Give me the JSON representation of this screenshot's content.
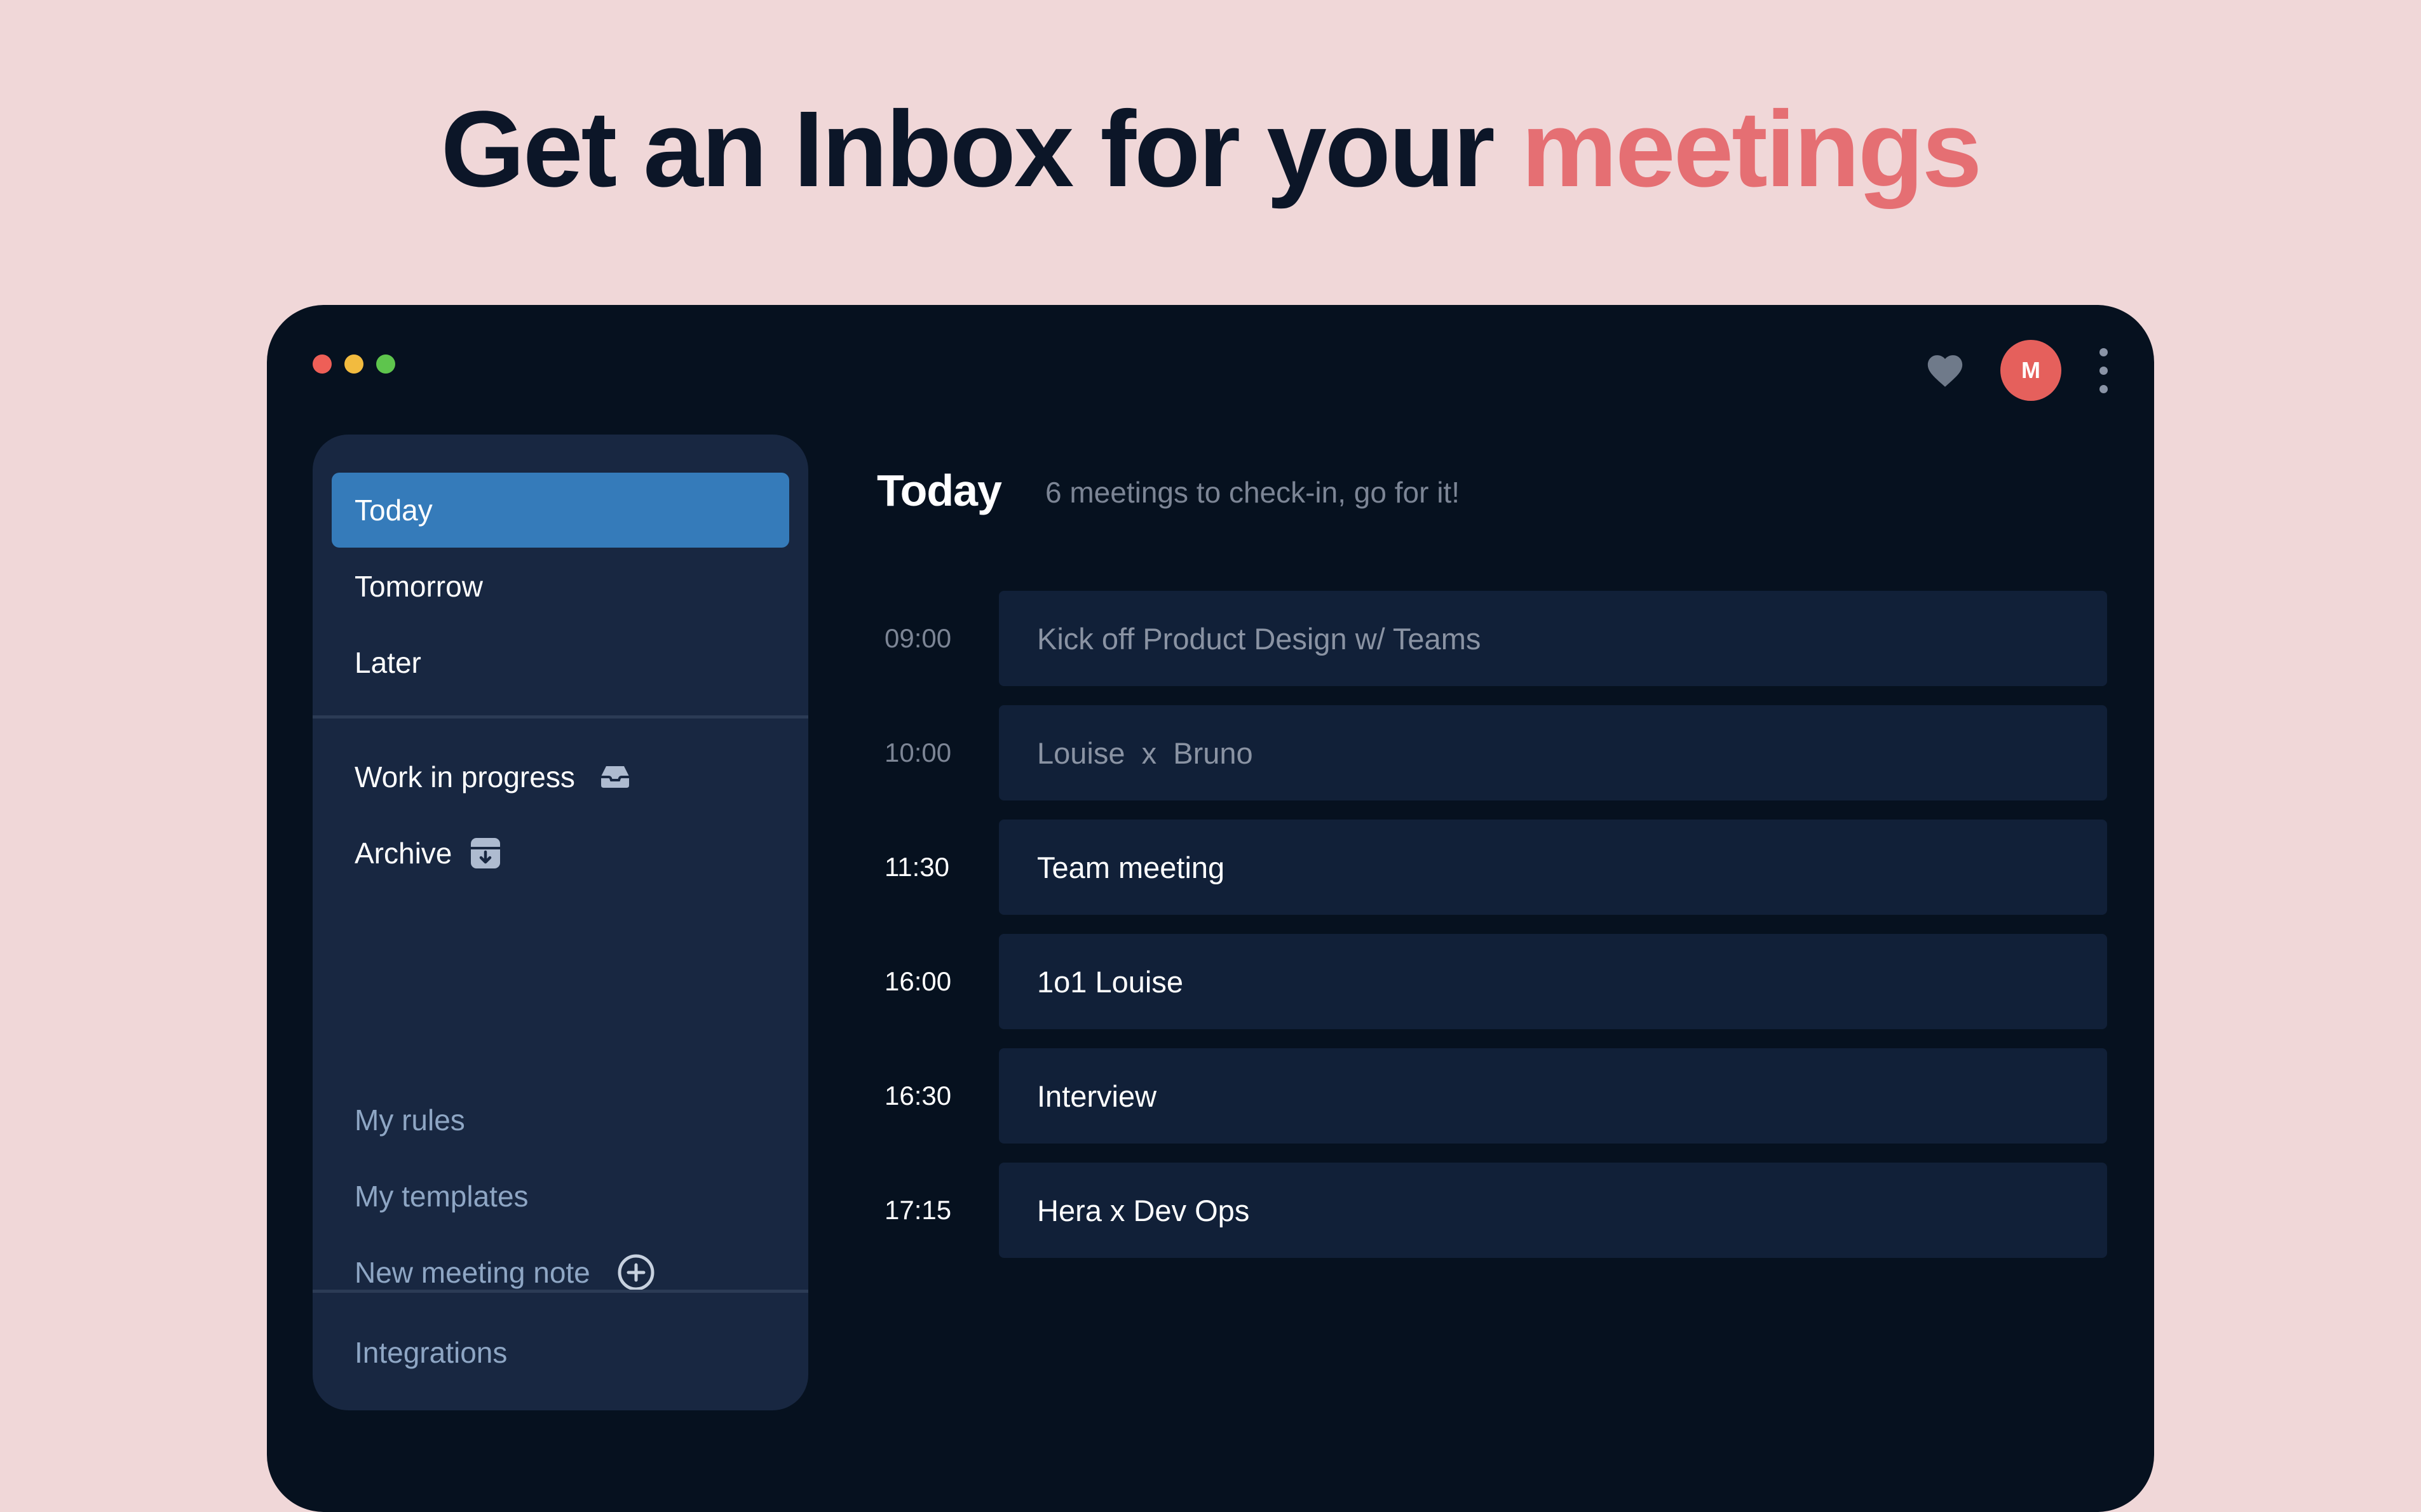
{
  "headline": {
    "main": "Get an Inbox for your",
    "accent": "meetings"
  },
  "colors": {
    "background": "#f0d7d8",
    "headline_text": "#0c1628",
    "headline_accent": "#e56f73",
    "window_bg": "#06111f",
    "sidebar_bg": "#182741",
    "active_item": "#357bba",
    "card_bg": "#112038",
    "avatar": "#e5605c",
    "traffic_close": "#ee5f57",
    "traffic_minimize": "#f2bb3f",
    "traffic_maximize": "#5ec54d"
  },
  "topbar": {
    "favorite_icon": "heart-icon",
    "avatar_initial": "M",
    "menu_icon": "more-vertical-icon"
  },
  "sidebar": {
    "primary": [
      {
        "label": "Today",
        "active": true
      },
      {
        "label": "Tomorrow"
      },
      {
        "label": "Later"
      }
    ],
    "secondary": [
      {
        "label": "Work in progress",
        "icon": "inbox-tray-icon"
      },
      {
        "label": "Archive",
        "icon": "archive-box-icon"
      }
    ],
    "tools": [
      {
        "label": "My rules"
      },
      {
        "label": "My templates"
      },
      {
        "label": "New meeting note",
        "icon": "plus-circle-icon"
      }
    ],
    "footer": {
      "label": "Integrations"
    }
  },
  "main": {
    "title": "Today",
    "subtitle": "6 meetings to check-in, go for it!",
    "meetings": [
      {
        "time": "09:00",
        "title": "Kick off Product Design w/ Teams",
        "past": true
      },
      {
        "time": "10:00",
        "title": "Louise  x  Bruno",
        "past": true
      },
      {
        "time": "11:30",
        "title": "Team meeting",
        "past": false
      },
      {
        "time": "16:00",
        "title": "1o1 Louise",
        "past": false
      },
      {
        "time": "16:30",
        "title": "Interview",
        "past": false
      },
      {
        "time": "17:15",
        "title": "Hera x Dev Ops",
        "past": false
      }
    ]
  }
}
